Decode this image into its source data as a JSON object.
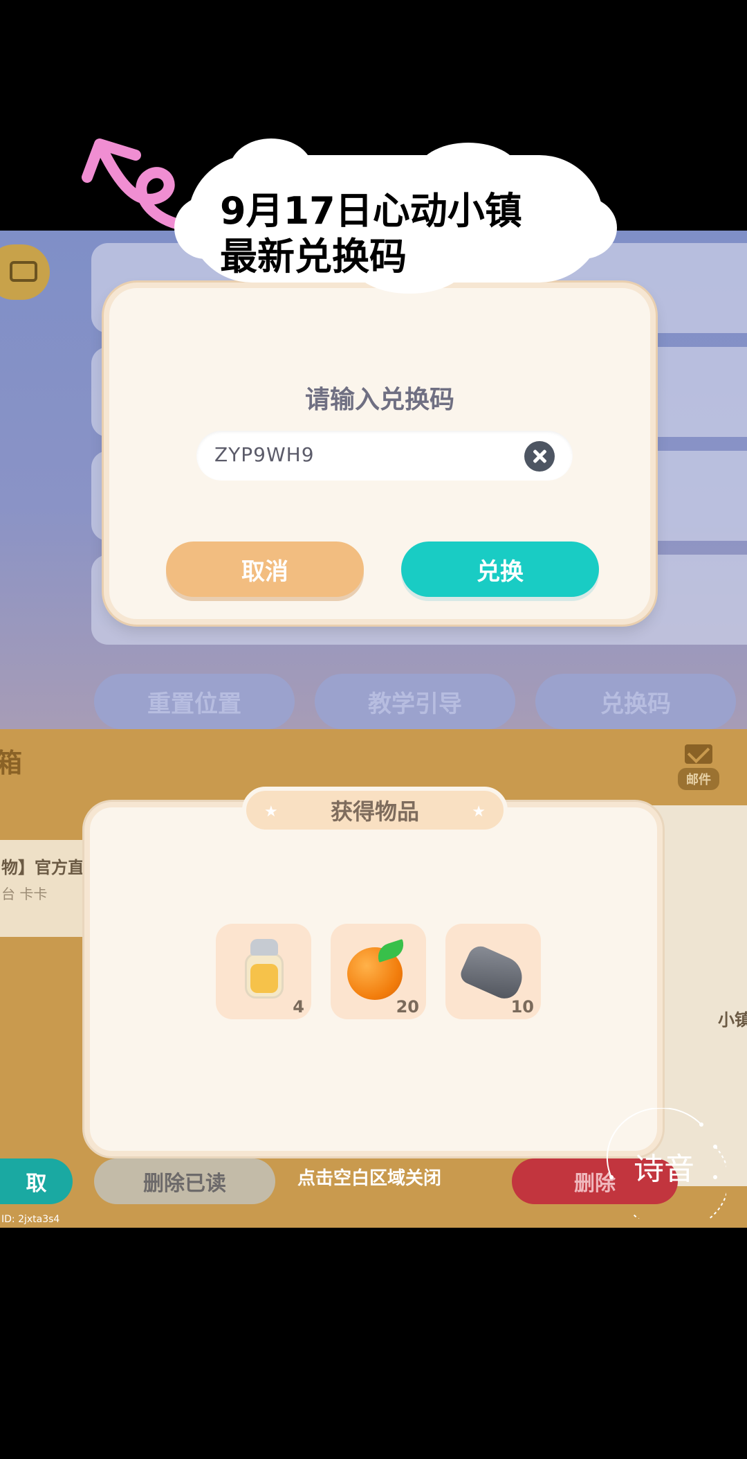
{
  "overlay": {
    "title_line_1": "9月17日心动小镇",
    "title_line_2": "最新兑换码"
  },
  "settings": {
    "buttons": [
      "重置位置",
      "教学引导",
      "兑换码"
    ]
  },
  "redeem_dialog": {
    "title": "请输入兑换码",
    "code_value": "ZYP9WH9",
    "cancel_label": "取消",
    "exchange_label": "兑换"
  },
  "mailbox": {
    "title_fragment": "箱",
    "mail_tab_label": "邮件",
    "list_item_title": "物】官方直",
    "list_item_sender": "台 卡卡",
    "side_text": "小镇",
    "claim_label": "取",
    "delete_read_label": "删除已读",
    "delete_label": "删除",
    "close_hint": "点击空白区域关闭",
    "user_id": "ID: 2jxta3s4"
  },
  "items_dialog": {
    "title": "获得物品",
    "rewards": [
      {
        "icon": "honey-jar-icon",
        "count": "4"
      },
      {
        "icon": "orange-icon",
        "count": "20"
      },
      {
        "icon": "stone-icon",
        "count": "10"
      }
    ]
  },
  "watermark": {
    "text": "诗音"
  }
}
